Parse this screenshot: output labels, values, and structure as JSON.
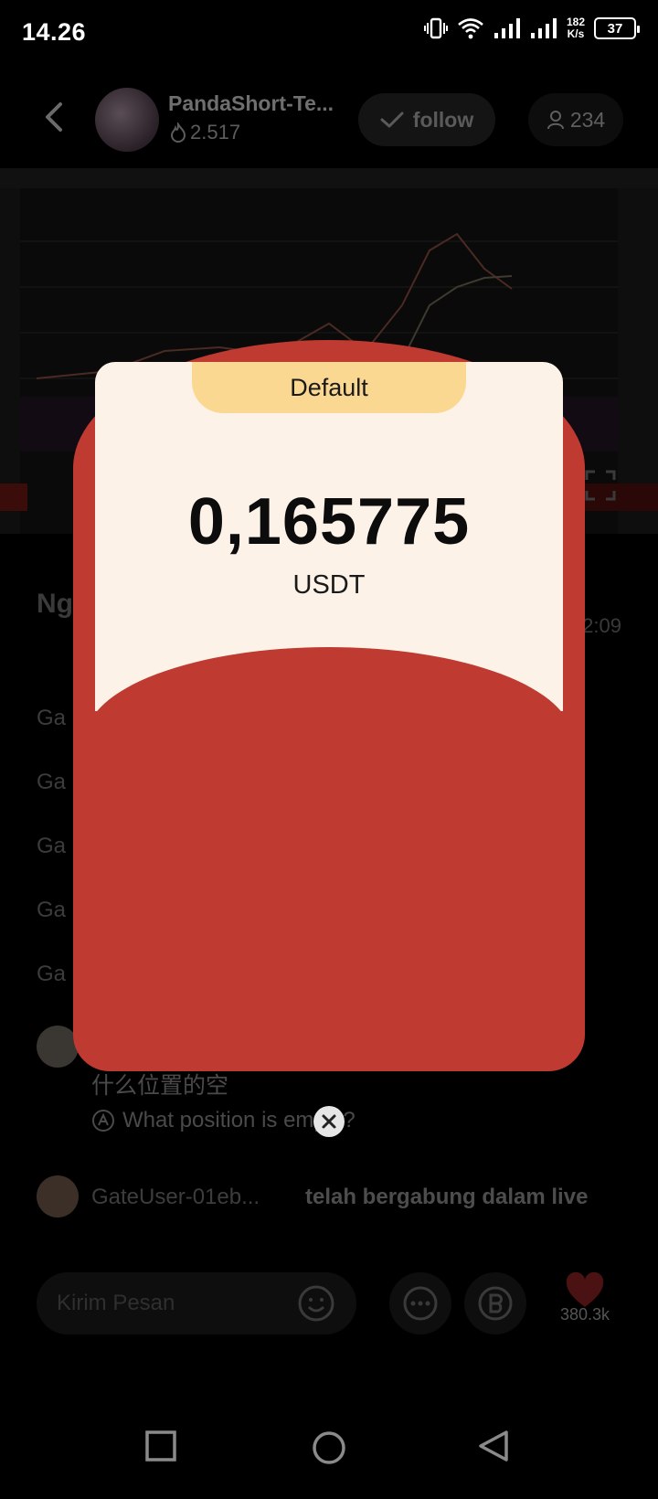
{
  "status_bar": {
    "time": "14.26",
    "net_speed_value": "182",
    "net_speed_unit": "K/s",
    "battery": "37"
  },
  "live": {
    "host_name": "PandaShort-Te...",
    "host_heat": "2.517",
    "follow_label": "follow",
    "viewer_count": "234"
  },
  "chat": {
    "title": "Ng",
    "time": "2:09",
    "items": [
      "Ga",
      "Ga",
      "Ga",
      "Ga",
      "Ga"
    ],
    "message_cn": "什么位置的空",
    "message_translated": "What position is empty?",
    "join_user": "GateUser-01eb...",
    "join_text": "telah bergabung dalam live"
  },
  "input": {
    "placeholder": "Kirim Pesan",
    "like_count": "380.3k"
  },
  "red_packet": {
    "tab_label": "Default",
    "amount": "0,165775",
    "currency": "USDT",
    "colors": {
      "packet": "#bf3a30",
      "card": "#fcf2e8",
      "tab": "#fbd892"
    }
  },
  "icons": {
    "close": "close-icon",
    "back": "back-arrow-icon",
    "like": "heart-icon"
  }
}
